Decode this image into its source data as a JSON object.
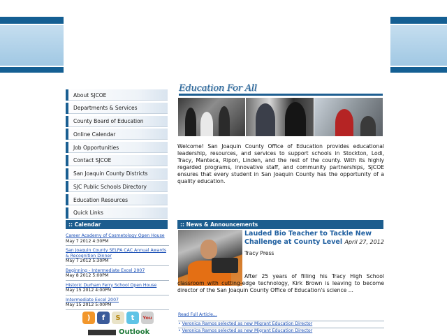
{
  "nav": {
    "items": [
      {
        "label": "About SJCOE"
      },
      {
        "label": "Departments & Services"
      },
      {
        "label": "County Board of Education"
      },
      {
        "label": "Online Calendar"
      },
      {
        "label": "Job Opportunities"
      },
      {
        "label": "Contact SJCOE"
      },
      {
        "label": "San Joaquin County Districts"
      },
      {
        "label": "SJC Public Schools Directory"
      },
      {
        "label": "Education Resources"
      },
      {
        "label": "Quick Links"
      }
    ]
  },
  "calendar": {
    "heading": ":: Calendar",
    "events": [
      {
        "title": "Career Academy of Cosmetology Open House",
        "date": "May 7 2012 4:30PM"
      },
      {
        "title": "San Joaquin County SELPA CAC Annual Awards & Recognition Dinner",
        "date": "May 7 2012 5:30PM"
      },
      {
        "title": "Beginning - Intermediate Excel 2007",
        "date": "May 8 2012 5:00PM"
      },
      {
        "title": "Historic Durham Ferry School Open House",
        "date": "May 15 2012 4:00PM"
      },
      {
        "title": "Intermediate Excel 2007",
        "date": "May 15 2012 5:00PM"
      }
    ]
  },
  "social": {
    "icons": [
      "rss-icon",
      "facebook-icon",
      "school-icon",
      "twitter-icon",
      "youtube-icon"
    ],
    "outlook_label": "Outlook"
  },
  "main": {
    "title": "Education For All",
    "welcome": "Welcome! San Joaquin County Office of Education provides educational leadership, resources, and services to support schools in Stockton, Lodi, Tracy, Manteca, Ripon, Linden, and the rest of the county. With its highly regarded programs, innovative staff, and community partnerships, SJCOE ensures that every student in San Joaquin County has the opportunity of a quality education."
  },
  "news": {
    "heading": ":: News & Announcements",
    "headline": "Lauded Bio Teacher to Tackle New Challenge at County Level",
    "date": "April 27, 2012",
    "source": "Tracy Press",
    "body": "After 25 years of filling his Tracy High School classroom with cutting-edge technology, Kirk Brown is leaving to become director of the San Joaquin County Office of Education's science ...",
    "read_full": "Read Full Article...",
    "more": [
      "Veronica Ramos selected as new Migrant Education Director",
      "Veronica Ramos selected as new Migrant Education Director"
    ]
  },
  "colors": {
    "brand_blue": "#1c5d8e",
    "link_blue": "#1a4fb5"
  }
}
